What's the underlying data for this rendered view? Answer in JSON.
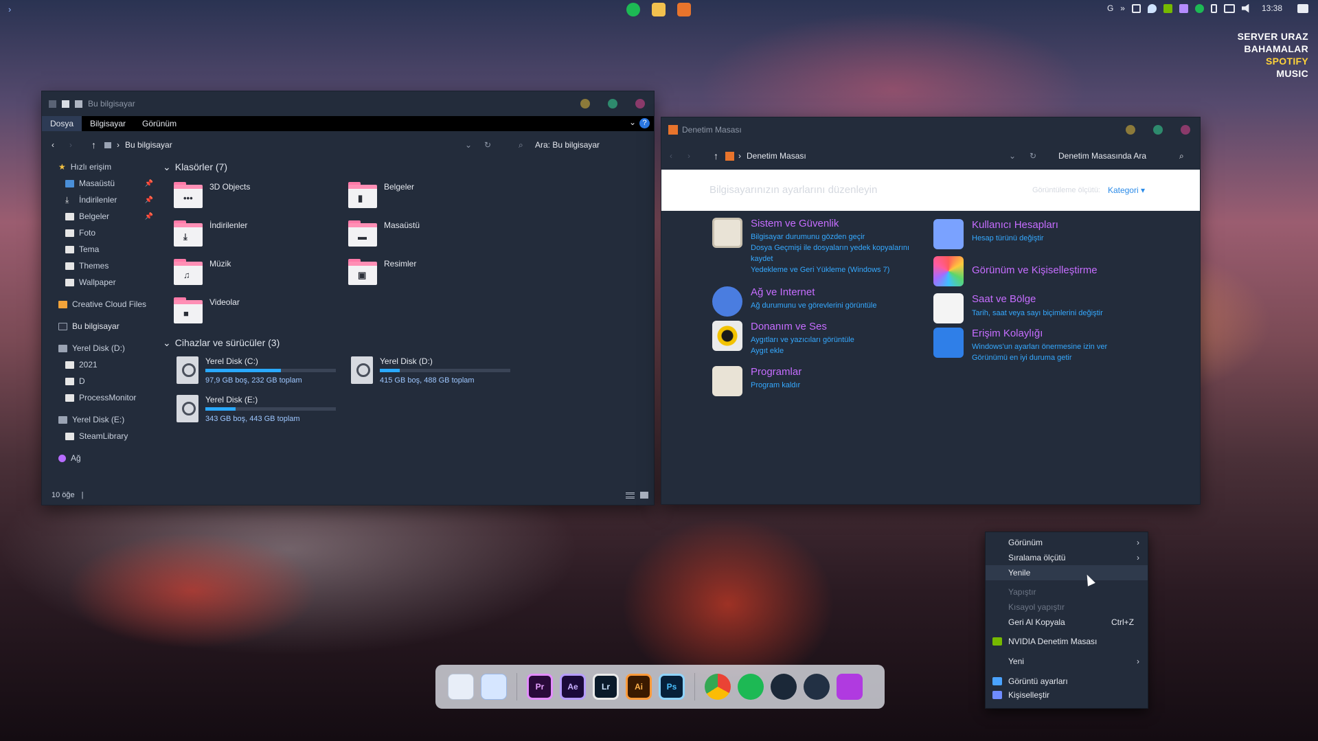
{
  "topbar": {
    "expand_icon": "chevron-right-icon",
    "pinned": [
      {
        "name": "spotify-icon",
        "color": "#1db954"
      },
      {
        "name": "file-explorer-icon",
        "color": "#f2c14e"
      },
      {
        "name": "control-panel-icon",
        "color": "#e8742c"
      }
    ],
    "tray": {
      "lang": "G",
      "overflow": "»",
      "time": "13:38"
    }
  },
  "music_widget": {
    "line1": "SERVER URAZ",
    "line2": "BAHAMALAR",
    "line3": "SPOTIFY",
    "line4": "MUSIC"
  },
  "explorer": {
    "title": "Bu bilgisayar",
    "ribbon": [
      "Dosya",
      "Bilgisayar",
      "Görünüm"
    ],
    "help": "?",
    "address": "Bu bilgisayar",
    "search_placeholder": "Ara: Bu bilgisayar",
    "sidebar": {
      "quick_access": "Hızlı erişim",
      "quick_items": [
        "Masaüstü",
        "İndirilenler",
        "Belgeler",
        "Foto",
        "Tema",
        "Themes",
        "Wallpaper"
      ],
      "creative_cloud": "Creative Cloud Files",
      "this_pc": "Bu bilgisayar",
      "disk_d": "Yerel Disk (D:)",
      "disk_d_items": [
        "2021",
        "D",
        "ProcessMonitor"
      ],
      "disk_e": "Yerel Disk (E:)",
      "disk_e_items": [
        "SteamLibrary"
      ],
      "network": "Ağ"
    },
    "folders_header": "Klasörler (7)",
    "folders": [
      "3D Objects",
      "Belgeler",
      "İndirilenler",
      "Masaüstü",
      "Müzik",
      "Resimler",
      "Videolar"
    ],
    "drives_header": "Cihazlar ve sürücüler (3)",
    "drives": [
      {
        "name": "Yerel Disk (C:)",
        "info": "97,9 GB boş, 232 GB toplam",
        "used": 0.58
      },
      {
        "name": "Yerel Disk (D:)",
        "info": "415 GB boş, 488 GB toplam",
        "used": 0.15
      },
      {
        "name": "Yerel Disk (E:)",
        "info": "343 GB boş, 443 GB toplam",
        "used": 0.23
      }
    ],
    "status": "10 öğe"
  },
  "cpanel": {
    "title": "Denetim Masası",
    "address": "Denetim Masası",
    "search_placeholder": "Denetim Masasında Ara",
    "banner_title": "Bilgisayarınızın ayarlarını düzenleyin",
    "view_by_label": "Görüntüleme ölçütü:",
    "view_by_value": "Kategori ▾",
    "categories_left": [
      {
        "title": "Sistem ve Güvenlik",
        "links": [
          "Bilgisayar durumunu gözden geçir",
          "Dosya Geçmişi ile dosyaların yedek kopyalarını kaydet",
          "Yedekleme ve Geri Yükleme (Windows 7)"
        ]
      },
      {
        "title": "Ağ ve Internet",
        "links": [
          "Ağ durumunu ve görevlerini görüntüle"
        ]
      },
      {
        "title": "Donanım ve Ses",
        "links": [
          "Aygıtları ve yazıcıları görüntüle",
          "Aygıt ekle"
        ]
      },
      {
        "title": "Programlar",
        "links": [
          "Program kaldır"
        ]
      }
    ],
    "categories_right": [
      {
        "title": "Kullanıcı Hesapları",
        "links": [
          "Hesap türünü değiştir"
        ]
      },
      {
        "title": "Görünüm ve Kişiselleştirme",
        "links": []
      },
      {
        "title": "Saat ve Bölge",
        "links": [
          "Tarih, saat veya sayı biçimlerini değiştir"
        ]
      },
      {
        "title": "Erişim Kolaylığı",
        "links": [
          "Windows'un ayarları önermesine izin ver",
          "Görünümü en iyi duruma getir"
        ]
      }
    ]
  },
  "context_menu": {
    "items": [
      "Görünüm",
      "Sıralama ölçütü",
      "Yenile",
      "Yapıştır",
      "Kısayol yapıştır",
      "Geri Al Kopyala",
      "NVIDIA Denetim Masası",
      "Yeni",
      "Görüntü ayarları",
      "Kişiselleştir"
    ],
    "shortcut_undo": "Ctrl+Z"
  },
  "dock": {
    "apps": [
      "Pr",
      "Ae",
      "Lr",
      "Ai",
      "Ps"
    ]
  }
}
